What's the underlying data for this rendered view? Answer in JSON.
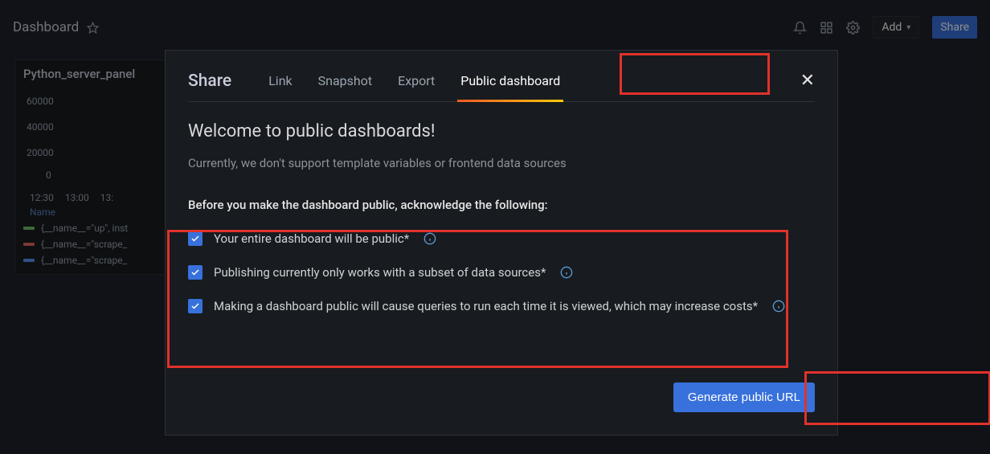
{
  "topbar": {
    "title": "Dashboard",
    "add_label": "Add",
    "share_label": "Share"
  },
  "panel": {
    "title": "Python_server_panel",
    "y_ticks": [
      "60000",
      "40000",
      "20000"
    ],
    "zero": "0",
    "x_ticks": [
      "12:30",
      "13:00",
      "13:"
    ],
    "legend_header": "Name",
    "series": [
      "{__name__=\"up\", inst",
      "{__name__=\"scrape_",
      "{__name__=\"scrape_"
    ]
  },
  "modal": {
    "title": "Share",
    "tabs": {
      "link": "Link",
      "snapshot": "Snapshot",
      "export": "Export",
      "public": "Public dashboard"
    },
    "heading": "Welcome to public dashboards!",
    "subtext": "Currently, we don't support template variables or frontend data sources",
    "ack_heading": "Before you make the dashboard public, acknowledge the following:",
    "checks": [
      "Your entire dashboard will be public*",
      "Publishing currently only works with a subset of data sources*",
      "Making a dashboard public will cause queries to run each time it is viewed, which may increase costs*"
    ],
    "generate_label": "Generate public URL"
  }
}
